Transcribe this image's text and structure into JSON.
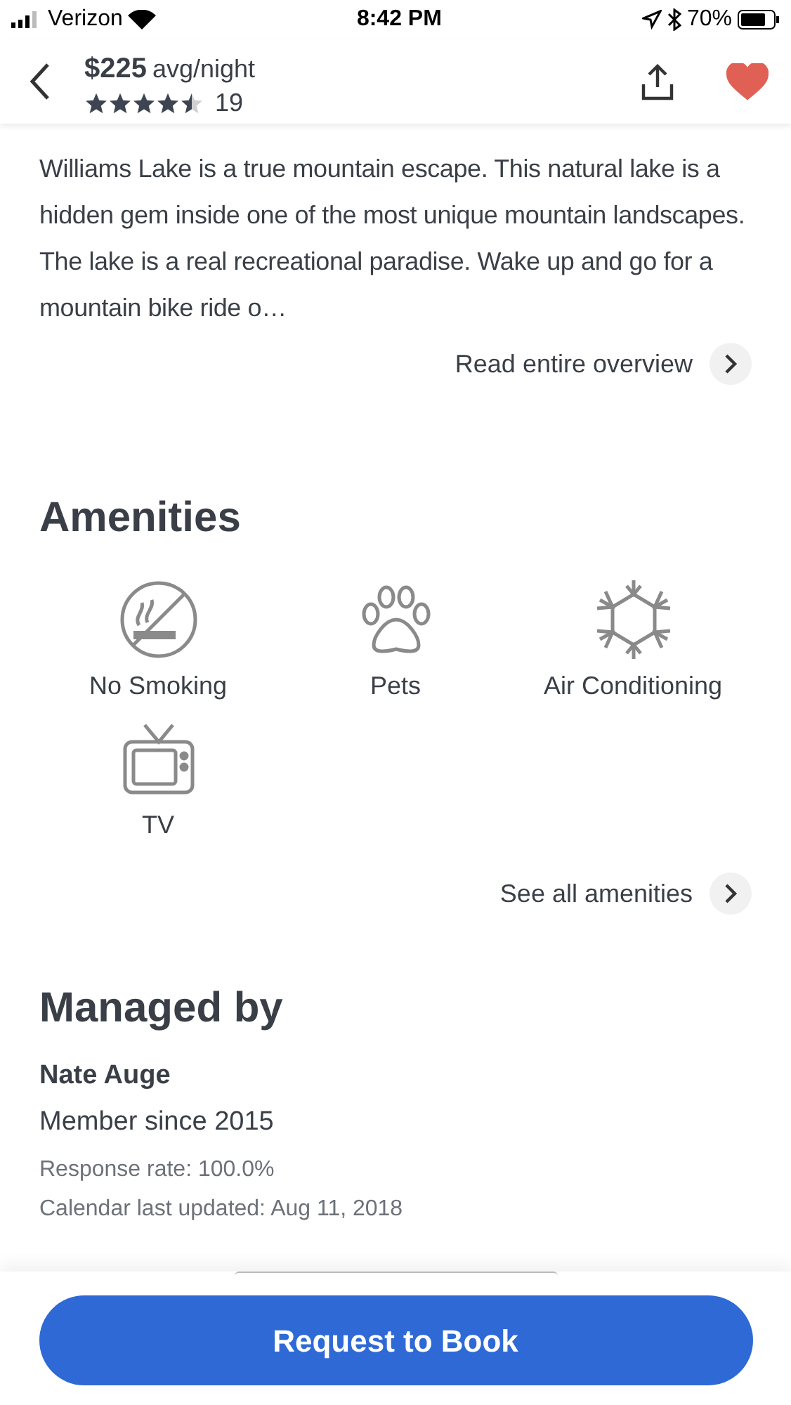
{
  "status_bar": {
    "carrier": "Verizon",
    "time": "8:42 PM",
    "battery": "70%"
  },
  "header": {
    "price": "$225",
    "price_unit": "avg/night",
    "stars": 4.5,
    "review_count": "19",
    "favorite": true
  },
  "overview": {
    "text": "Williams Lake is a true mountain escape. This natural lake is a hidden gem inside one of the most unique mountain landscapes. The lake is a real recreational paradise. Wake up and go for a mountain bike ride o…",
    "link": "Read entire overview"
  },
  "amenities": {
    "title": "Amenities",
    "items": [
      {
        "kind": "no-smoking",
        "label": "No Smoking"
      },
      {
        "kind": "pets",
        "label": "Pets"
      },
      {
        "kind": "snowflake",
        "label": "Air Conditioning"
      },
      {
        "kind": "tv",
        "label": "TV"
      }
    ],
    "link": "See all amenities"
  },
  "manager": {
    "title": "Managed by",
    "name": "Nate Auge",
    "member_since": "Member since 2015",
    "response_rate": "Response rate: 100.0%",
    "calendar_updated": "Calendar last updated: Aug 11, 2018"
  },
  "book_button": "Request to Book"
}
